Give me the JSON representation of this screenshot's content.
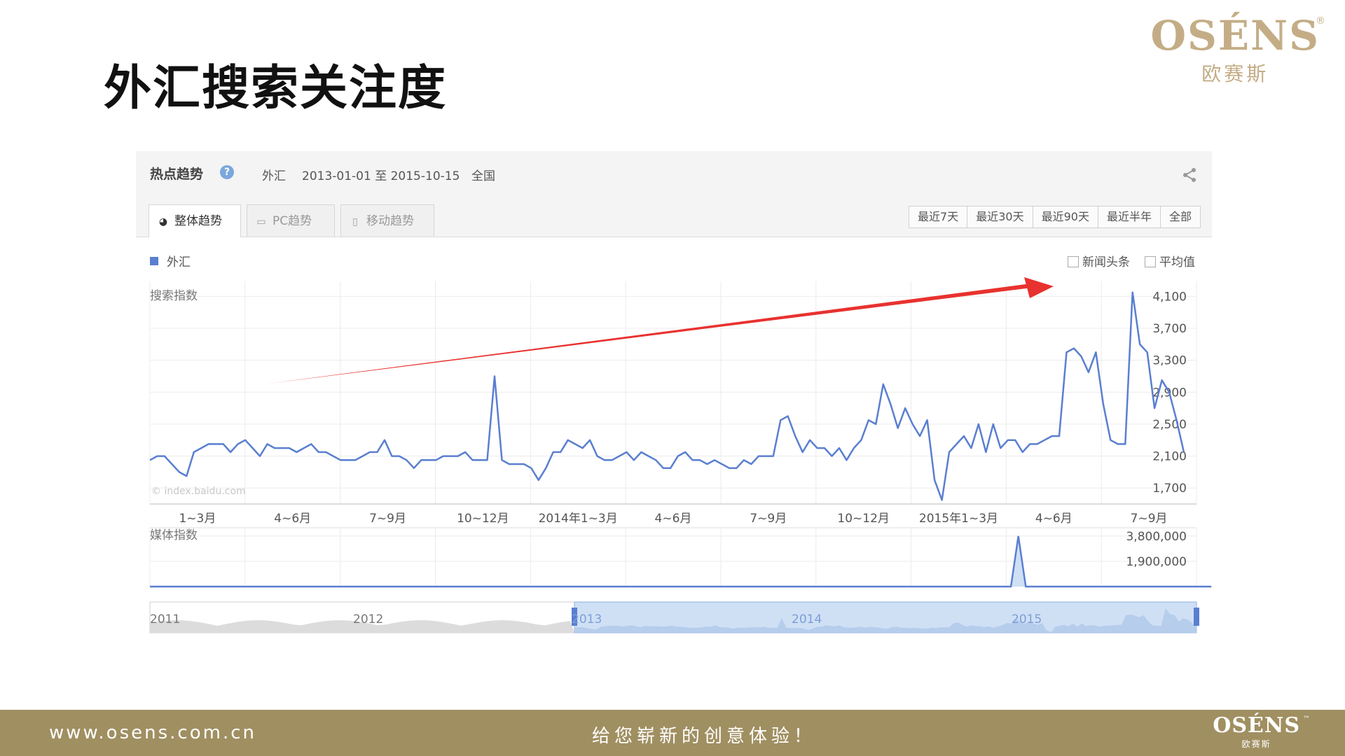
{
  "slide": {
    "title": "外汇搜索关注度"
  },
  "logo": {
    "word": "OSÉNS",
    "reg": "®",
    "cn": "欧赛斯"
  },
  "panel": {
    "head_title": "热点趋势",
    "keyword": "外汇",
    "date_range": "2013-01-01 至 2015-10-15",
    "region": "全国",
    "tabs": [
      {
        "label": "整体趋势",
        "icon": "pie-icon"
      },
      {
        "label": "PC趋势",
        "icon": "monitor-icon"
      },
      {
        "label": "移动趋势",
        "icon": "mobile-icon"
      }
    ],
    "ranges": [
      "最近7天",
      "最近30天",
      "最近90天",
      "最近半年",
      "全部"
    ],
    "legend": "外汇",
    "options": [
      "新闻头条",
      "平均值"
    ],
    "watermark": "© index.baidu.com"
  },
  "chart_data": [
    {
      "type": "line",
      "title": "",
      "ylabel": "搜索指数",
      "y_ticks": [
        1700,
        2100,
        2500,
        2900,
        3300,
        3700,
        4100
      ],
      "y_tick_labels": [
        "1,700",
        "2,100",
        "2,500",
        "2,900",
        "3,300",
        "3,700",
        "4,100"
      ],
      "ylim": [
        1500,
        4200
      ],
      "x_tick_labels": [
        "1~3月",
        "4~6月",
        "7~9月",
        "10~12月",
        "2014年1~3月",
        "4~6月",
        "7~9月",
        "10~12月",
        "2015年1~3月",
        "4~6月",
        "7~9月"
      ],
      "series": [
        {
          "name": "外汇",
          "color": "#5a7fd0",
          "values": [
            2050,
            2100,
            2100,
            2000,
            1900,
            1850,
            2150,
            2200,
            2250,
            2250,
            2250,
            2150,
            2250,
            2300,
            2200,
            2100,
            2250,
            2200,
            2200,
            2200,
            2150,
            2200,
            2250,
            2150,
            2150,
            2100,
            2050,
            2050,
            2050,
            2100,
            2150,
            2150,
            2300,
            2100,
            2100,
            2050,
            1950,
            2050,
            2050,
            2050,
            2100,
            2100,
            2100,
            2150,
            2050,
            2050,
            2050,
            3100,
            2050,
            2000,
            2000,
            2000,
            1950,
            1800,
            1950,
            2150,
            2150,
            2300,
            2250,
            2200,
            2300,
            2100,
            2050,
            2050,
            2100,
            2150,
            2050,
            2150,
            2100,
            2050,
            1950,
            1950,
            2100,
            2150,
            2050,
            2050,
            2000,
            2050,
            2000,
            1950,
            1950,
            2050,
            2000,
            2100,
            2100,
            2100,
            2550,
            2600,
            2350,
            2150,
            2300,
            2200,
            2200,
            2100,
            2200,
            2050,
            2200,
            2300,
            2550,
            2500,
            3000,
            2750,
            2450,
            2700,
            2500,
            2350,
            2550,
            1800,
            1550,
            2150,
            2250,
            2350,
            2200,
            2500,
            2150,
            2500,
            2200,
            2300,
            2300,
            2150,
            2250,
            2250,
            2300,
            2350,
            2350,
            3400,
            3450,
            3350,
            3150,
            3400,
            2750,
            2300,
            2250,
            2250,
            4150,
            3500,
            3400,
            2700,
            3050,
            2900,
            2550,
            2150
          ]
        }
      ],
      "grid": true,
      "legend": "top-left"
    },
    {
      "type": "area",
      "title": "",
      "ylabel": "媒体指数",
      "y_ticks": [
        1900000,
        3800000
      ],
      "y_tick_labels": [
        "1,900,000",
        "3,800,000"
      ],
      "ylim": [
        0,
        4000000
      ],
      "series": [
        {
          "name": "外汇",
          "points": [
            [
              0,
              0
            ],
            [
              116,
              0
            ],
            [
              117,
              3800000
            ],
            [
              118,
              0
            ],
            [
              143,
              0
            ]
          ]
        }
      ],
      "grid": true
    },
    {
      "type": "area",
      "title": "",
      "x_tick_labels": [
        "2011",
        "2012",
        "2013",
        "2014",
        "2015"
      ],
      "selected_range": [
        "2013",
        "2015"
      ]
    }
  ],
  "footer": {
    "url": "www.osens.com.cn",
    "slogan": "给您崭新的创意体验！",
    "logo_word": "OSÉNS",
    "logo_cn": "欧赛斯",
    "logo_tm": "™"
  },
  "colors": {
    "series": "#5a7fd0",
    "arrow": "#e8322f",
    "footer": "#a08f61",
    "logo": "#c4ad86",
    "navigator_fill": "#cfe0f5"
  }
}
